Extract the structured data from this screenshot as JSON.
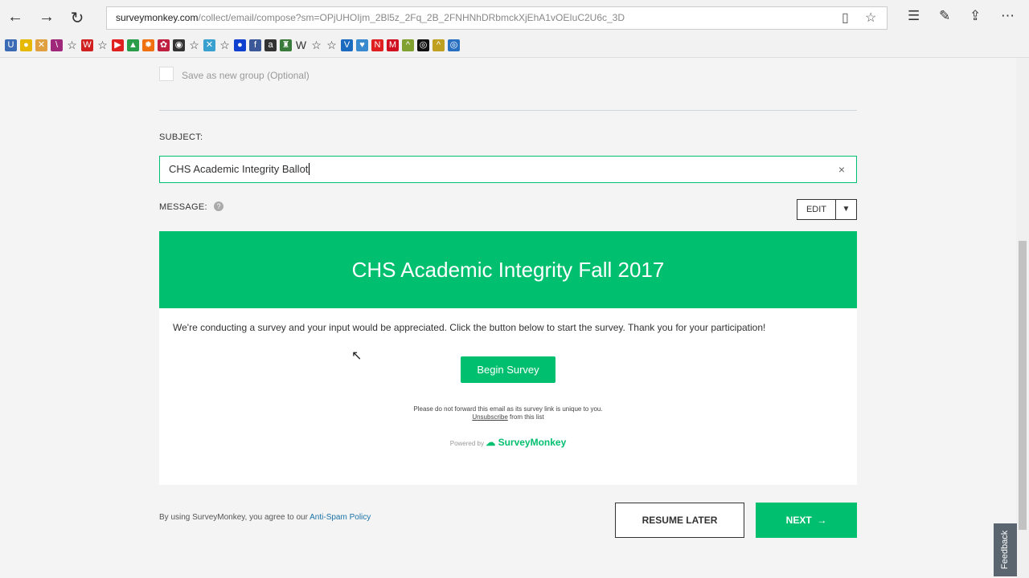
{
  "browser": {
    "url_domain": "surveymonkey.com",
    "url_path": "/collect/email/compose?sm=OPjUHOIjm_2Bl5z_2Fq_2B_2FNHNhDRbmckXjEhA1vOEIuC2U6c_3D",
    "bookmarks": [
      {
        "g": "U",
        "c": "#3b6bb5"
      },
      {
        "g": "●",
        "c": "#e6b800"
      },
      {
        "g": "✕",
        "c": "#e0a040"
      },
      {
        "g": "\\",
        "c": "#a0287a"
      },
      {
        "g": "☆",
        "c": "none"
      },
      {
        "g": "W",
        "c": "#d02020"
      },
      {
        "g": "☆",
        "c": "none"
      },
      {
        "g": "▶",
        "c": "#e02020"
      },
      {
        "g": "▲",
        "c": "#2a9d4a"
      },
      {
        "g": "✹",
        "c": "#f07010"
      },
      {
        "g": "✿",
        "c": "#c02040"
      },
      {
        "g": "◉",
        "c": "#333"
      },
      {
        "g": "☆",
        "c": "none"
      },
      {
        "g": "✕",
        "c": "#3aa0d0"
      },
      {
        "g": "☆",
        "c": "none"
      },
      {
        "g": "●",
        "c": "#1040d0"
      },
      {
        "g": "f",
        "c": "#3b5998"
      },
      {
        "g": "a",
        "c": "#333"
      },
      {
        "g": "♜",
        "c": "#3a7a3a"
      },
      {
        "g": "W",
        "c": "none"
      },
      {
        "g": "☆",
        "c": "none"
      },
      {
        "g": "☆",
        "c": "none"
      },
      {
        "g": "V",
        "c": "#1a6ac0"
      },
      {
        "g": "♥",
        "c": "#3a8ad0"
      },
      {
        "g": "N",
        "c": "#e02020"
      },
      {
        "g": "M",
        "c": "#d01020"
      },
      {
        "g": "^",
        "c": "#80a030"
      },
      {
        "g": "◎",
        "c": "#111"
      },
      {
        "g": "^",
        "c": "#c0a020"
      },
      {
        "g": "◎",
        "c": "#2a70c0"
      }
    ]
  },
  "form": {
    "save_group_label": "Save as new group (Optional)",
    "subject_label": "SUBJECT:",
    "subject_value": "CHS Academic Integrity Ballot",
    "clear_icon": "×",
    "message_label": "MESSAGE:",
    "help_icon": "?",
    "edit_label": "EDIT"
  },
  "email": {
    "title": "CHS Academic Integrity Fall 2017",
    "body": "We're conducting a survey and your input would be appreciated. Click the button below to start the survey. Thank you for your participation!",
    "button": "Begin Survey",
    "forward_note": "Please do not forward this email as its survey link is unique to you.",
    "unsubscribe": "Unsubscribe",
    "unsubscribe_rest": " from this list",
    "powered_by": "Powered by",
    "brand": "SurveyMonkey"
  },
  "footer": {
    "agree": "By using SurveyMonkey, you agree to our ",
    "policy": "Anti-Spam Policy",
    "resume": "RESUME LATER",
    "next": "NEXT"
  },
  "feedback": "Feedback",
  "colors": {
    "accent": "#00bf6f"
  }
}
